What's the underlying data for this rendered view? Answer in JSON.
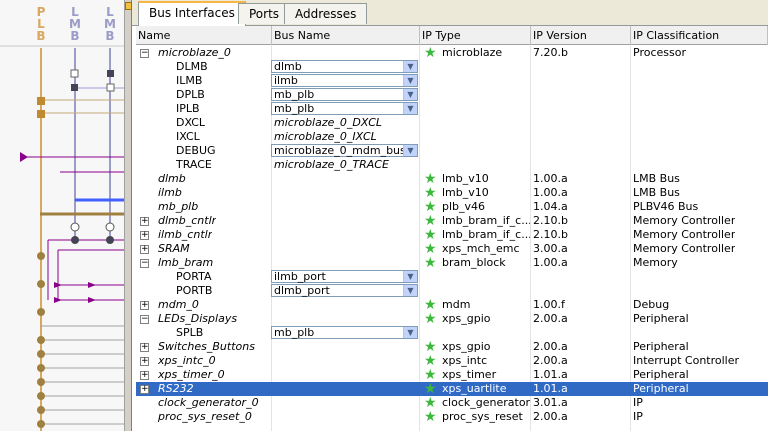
{
  "left_panel": {
    "bus_headers": [
      "PLB",
      "LMB",
      "LMB"
    ]
  },
  "tabs": [
    "Bus Interfaces",
    "Ports",
    "Addresses"
  ],
  "columns": [
    "Name",
    "Bus Name",
    "IP Type",
    "IP Version",
    "IP Classification"
  ],
  "rows": [
    {
      "exp": "−",
      "name": "microblaze_0",
      "italic": true,
      "ip_type": "microblaze",
      "star": true,
      "version": "7.20.b",
      "cls": "Processor"
    },
    {
      "name": "DLMB",
      "indent": true,
      "bus": "dlmb",
      "combo": true
    },
    {
      "name": "ILMB",
      "indent": true,
      "bus": "ilmb",
      "combo": true
    },
    {
      "name": "DPLB",
      "indent": true,
      "bus": "mb_plb",
      "combo": true
    },
    {
      "name": "IPLB",
      "indent": true,
      "bus": "mb_plb",
      "combo": true
    },
    {
      "name": "DXCL",
      "indent": true,
      "bus": "microblaze_0_DXCL",
      "bus_italic": true
    },
    {
      "name": "IXCL",
      "indent": true,
      "bus": "microblaze_0_IXCL",
      "bus_italic": true
    },
    {
      "name": "DEBUG",
      "indent": true,
      "bus": "microblaze_0_mdm_bus",
      "combo": true
    },
    {
      "name": "TRACE",
      "indent": true,
      "bus": "microblaze_0_TRACE",
      "bus_italic": true
    },
    {
      "name": "dlmb",
      "italic": true,
      "ip_type": "lmb_v10",
      "star": true,
      "version": "1.00.a",
      "cls": "LMB Bus"
    },
    {
      "name": "ilmb",
      "italic": true,
      "ip_type": "lmb_v10",
      "star": true,
      "version": "1.00.a",
      "cls": "LMB Bus"
    },
    {
      "name": "mb_plb",
      "italic": true,
      "ip_type": "plb_v46",
      "star": true,
      "version": "1.04.a",
      "cls": "PLBV46 Bus"
    },
    {
      "exp": "+",
      "name": "dlmb_cntlr",
      "italic": true,
      "ip_type": "lmb_bram_if_c...",
      "star": true,
      "version": "2.10.b",
      "cls": "Memory Controller"
    },
    {
      "exp": "+",
      "name": "ilmb_cntlr",
      "italic": true,
      "ip_type": "lmb_bram_if_c...",
      "star": true,
      "version": "2.10.b",
      "cls": "Memory Controller"
    },
    {
      "exp": "+",
      "name": "SRAM",
      "italic": true,
      "ip_type": "xps_mch_emc",
      "star": true,
      "version": "3.00.a",
      "cls": "Memory Controller"
    },
    {
      "exp": "−",
      "name": "lmb_bram",
      "italic": true,
      "ip_type": "bram_block",
      "star": true,
      "version": "1.00.a",
      "cls": "Memory"
    },
    {
      "name": "PORTA",
      "indent": true,
      "bus": "ilmb_port",
      "combo": true
    },
    {
      "name": "PORTB",
      "indent": true,
      "bus": "dlmb_port",
      "combo": true
    },
    {
      "exp": "+",
      "name": "mdm_0",
      "italic": true,
      "ip_type": "mdm",
      "star": true,
      "version": "1.00.f",
      "cls": "Debug"
    },
    {
      "exp": "−",
      "name": "LEDs_Displays",
      "italic": true,
      "ip_type": "xps_gpio",
      "star": true,
      "version": "2.00.a",
      "cls": "Peripheral"
    },
    {
      "name": "SPLB",
      "indent": true,
      "bus": "mb_plb",
      "combo": true
    },
    {
      "exp": "+",
      "name": "Switches_Buttons",
      "italic": true,
      "ip_type": "xps_gpio",
      "star": true,
      "version": "2.00.a",
      "cls": "Peripheral"
    },
    {
      "exp": "+",
      "name": "xps_intc_0",
      "italic": true,
      "ip_type": "xps_intc",
      "star": true,
      "version": "2.00.a",
      "cls": "Interrupt Controller"
    },
    {
      "exp": "+",
      "name": "xps_timer_0",
      "italic": true,
      "ip_type": "xps_timer",
      "star": true,
      "version": "1.01.a",
      "cls": "Peripheral"
    },
    {
      "exp": "+",
      "name": "RS232",
      "italic": true,
      "ip_type": "xps_uartlite",
      "star": true,
      "version": "1.01.a",
      "cls": "Peripheral",
      "selected": true
    },
    {
      "name": "clock_generator_0",
      "italic": true,
      "ip_type": "clock_generator",
      "star": true,
      "version": "3.01.a",
      "cls": "IP"
    },
    {
      "name": "proc_sys_reset_0",
      "italic": true,
      "ip_type": "proc_sys_reset",
      "star": true,
      "version": "2.00.a",
      "cls": "IP"
    }
  ]
}
